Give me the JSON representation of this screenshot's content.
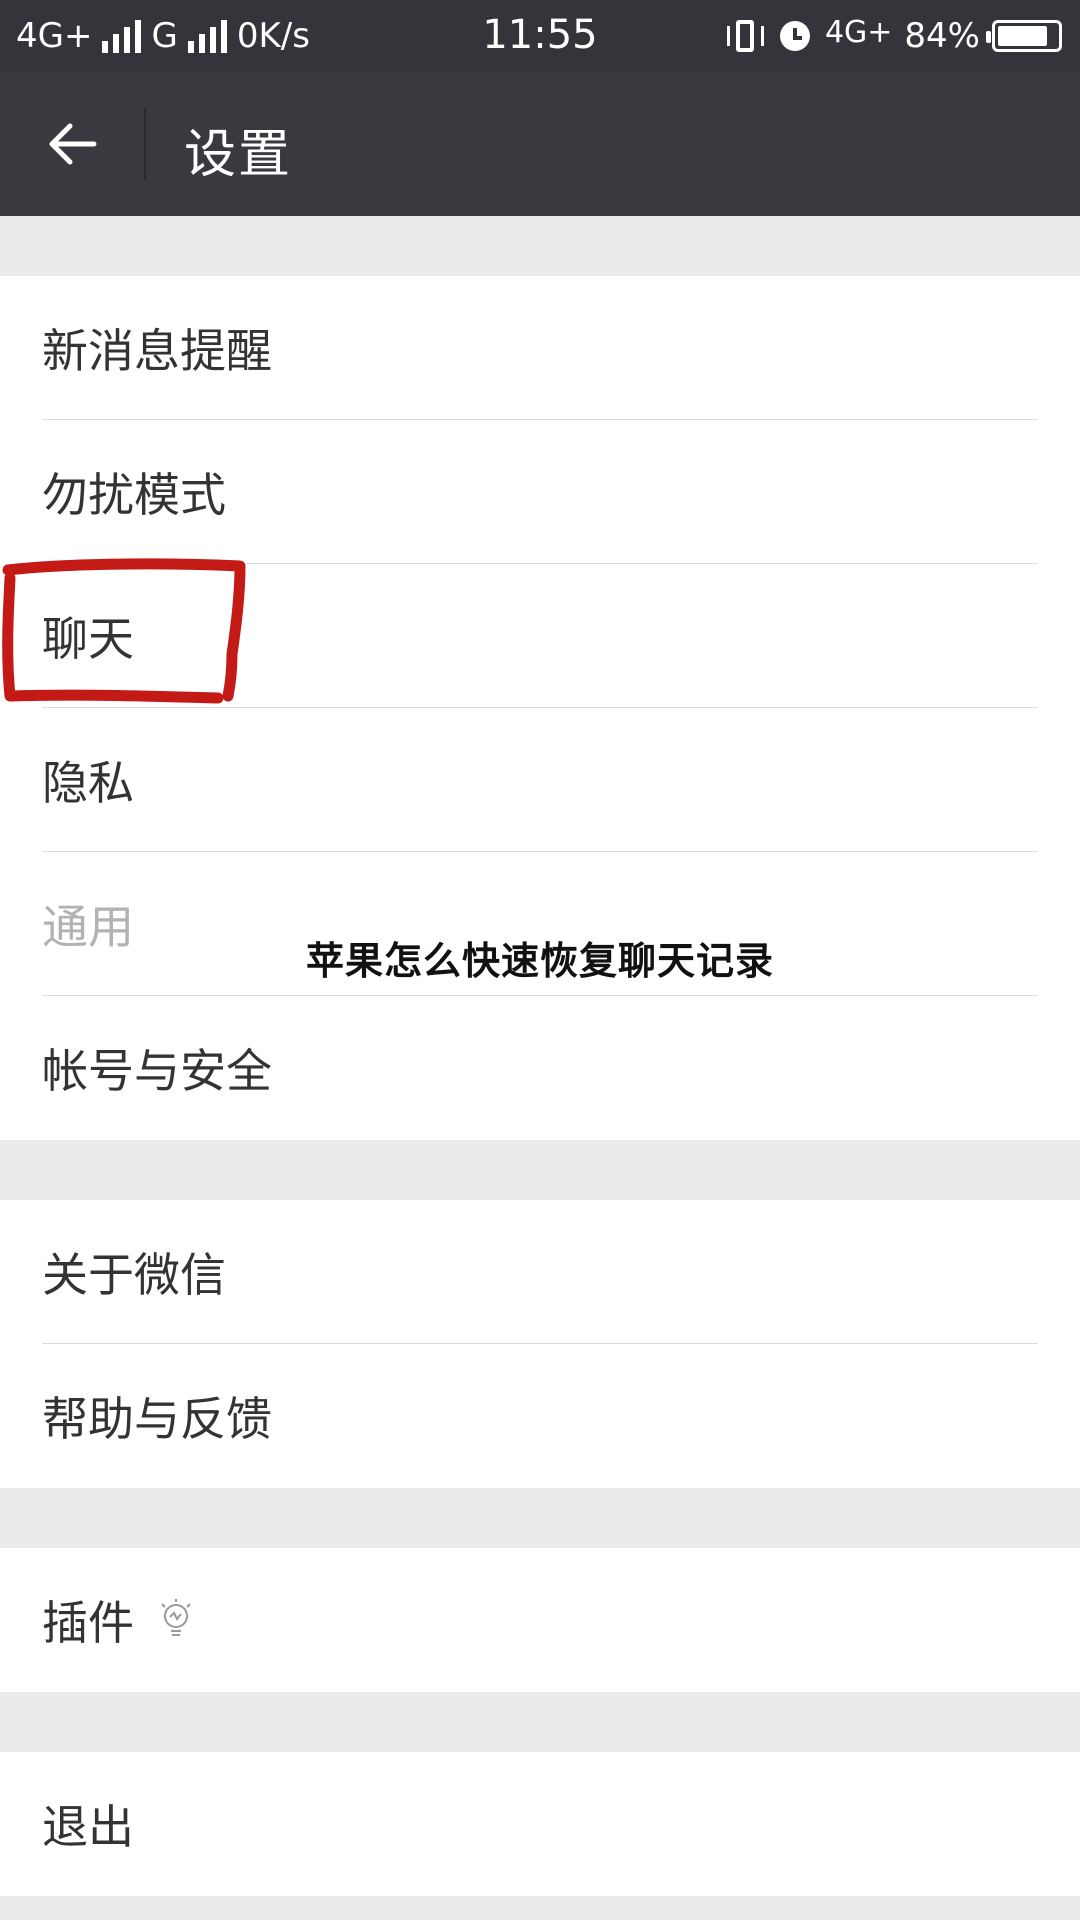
{
  "status_bar": {
    "network1": "4G+",
    "network2": "G",
    "speed": "0K/s",
    "time": "11:55",
    "network3": "4G",
    "battery": "84%",
    "battery_level": 0.84
  },
  "header": {
    "title": "设置"
  },
  "groups": [
    {
      "items": [
        {
          "label": "新消息提醒"
        },
        {
          "label": "勿扰模式"
        },
        {
          "label": "聊天"
        },
        {
          "label": "隐私"
        },
        {
          "label": "通用"
        },
        {
          "label": "帐号与安全"
        }
      ]
    },
    {
      "items": [
        {
          "label": "关于微信"
        },
        {
          "label": "帮助与反馈"
        }
      ]
    },
    {
      "items": [
        {
          "label": "插件",
          "icon": "lightbulb-icon"
        }
      ]
    },
    {
      "items": [
        {
          "label": "退出"
        }
      ]
    }
  ],
  "overlay": {
    "caption": "苹果怎么快速恢复聊天记录",
    "highlight_color": "#c41a16"
  },
  "colors": {
    "status_bar": "#33353a",
    "title_bar": "#393a3f",
    "background": "#ebebeb"
  }
}
